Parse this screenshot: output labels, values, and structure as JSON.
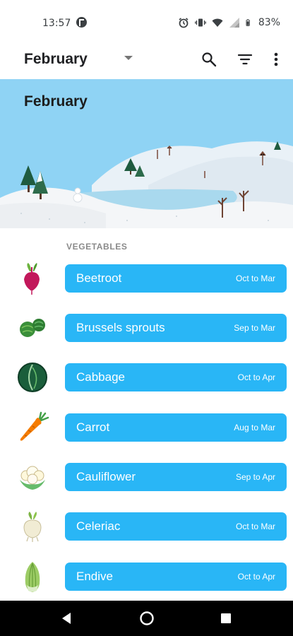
{
  "status_bar": {
    "time": "13:57",
    "battery_text": "83%",
    "icons": [
      "app-notification-icon",
      "alarm-icon",
      "vibrate-icon",
      "wifi-icon",
      "signal-icon",
      "battery-icon"
    ]
  },
  "app_bar": {
    "month": "February",
    "actions": [
      "search-icon",
      "filter-icon",
      "more-vert-icon"
    ]
  },
  "hero": {
    "title": "February"
  },
  "section": {
    "title": "VEGETABLES"
  },
  "vegetables": [
    {
      "name": "Beetroot",
      "season": "Oct to Mar",
      "icon": "beetroot-icon"
    },
    {
      "name": "Brussels sprouts",
      "season": "Sep to Mar",
      "icon": "brussels-sprouts-icon"
    },
    {
      "name": "Cabbage",
      "season": "Oct to Apr",
      "icon": "cabbage-icon"
    },
    {
      "name": "Carrot",
      "season": "Aug to Mar",
      "icon": "carrot-icon"
    },
    {
      "name": "Cauliflower",
      "season": "Sep to Apr",
      "icon": "cauliflower-icon"
    },
    {
      "name": "Celeriac",
      "season": "Oct to Mar",
      "icon": "celeriac-icon"
    },
    {
      "name": "Endive",
      "season": "Oct to Apr",
      "icon": "endive-icon"
    }
  ],
  "colors": {
    "pill": "#29b6f6",
    "sky": "#8fd3f4",
    "nav_bar": "#000000"
  },
  "nav_bar": {
    "buttons": [
      "back-icon",
      "home-icon",
      "recents-icon"
    ]
  }
}
